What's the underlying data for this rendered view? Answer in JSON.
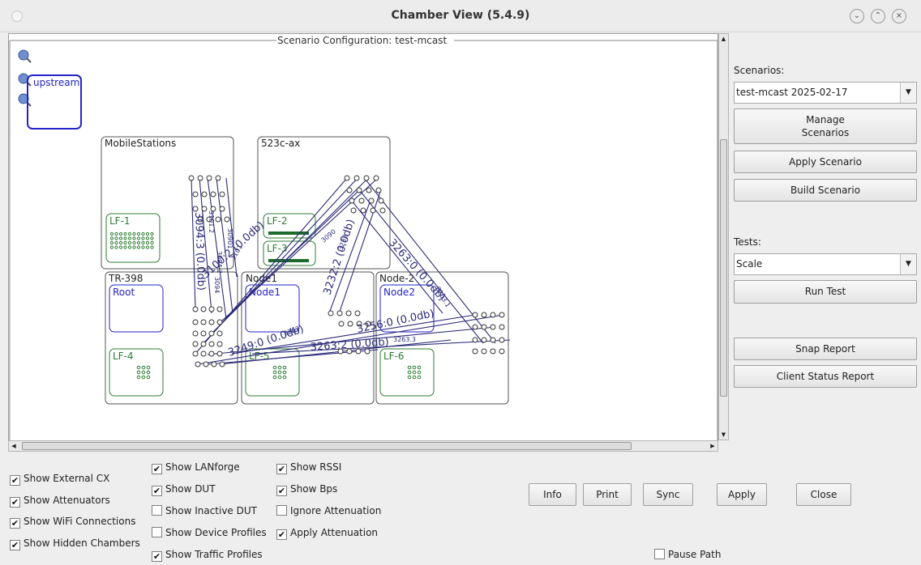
{
  "window": {
    "title": "Chamber View (5.4.9)"
  },
  "canvas": {
    "frame_title": "Scenario Configuration:  test-mcast",
    "zoom_icons": [
      "zoom-in-icon",
      "zoom-out-icon",
      "zoom-reset-icon"
    ],
    "upstream_label": "upstream",
    "chambers": [
      {
        "name": "MobileStations"
      },
      {
        "name": "523c-ax"
      },
      {
        "name": "TR-398"
      },
      {
        "name": "Node1"
      },
      {
        "name": "Node-2"
      }
    ],
    "devices": [
      {
        "name": "LF-1",
        "color": "#2e7d32"
      },
      {
        "name": "LF-2",
        "color": "#2e7d32"
      },
      {
        "name": "LF-3",
        "color": "#2e7d32"
      },
      {
        "name": "Root",
        "color": "#2323c8"
      },
      {
        "name": "Node1",
        "color": "#2323c8"
      },
      {
        "name": "Node2",
        "color": "#2323c8"
      },
      {
        "name": "LF-4",
        "color": "#2e7d32"
      },
      {
        "name": "LF-5",
        "color": "#2e7d32"
      },
      {
        "name": "LF-6",
        "color": "#2e7d32"
      }
    ],
    "link_labels": [
      "3094:3 (0.0db)",
      "3100:2 (0.0db)",
      "3232:2 (0.0db)",
      "3249:0 (0.0db)",
      "3263:2 (0.0db)",
      "3256:0 (0.0db)",
      "3263:0 (0.0db)"
    ],
    "small_labels": [
      "3101.2",
      "30901",
      "3094.2",
      "3101",
      "3090",
      "3232",
      "3263.3",
      "3263.1",
      "3094",
      "3263"
    ]
  },
  "right_panel": {
    "scenarios_label": "Scenarios:",
    "scenario_value": "test-mcast 2025-02-17",
    "manage_line1": "Manage",
    "manage_line2": "Scenarios",
    "apply_scenario": "Apply Scenario",
    "build_scenario": "Build Scenario",
    "tests_label": "Tests:",
    "test_value": "Scale",
    "run_test": "Run Test",
    "snap_report": "Snap Report",
    "client_status_report": "Client Status Report"
  },
  "checkboxes": [
    {
      "label": "Show External CX",
      "checked": true
    },
    {
      "label": "Show Attenuators",
      "checked": true
    },
    {
      "label": "Show WiFi Connections",
      "checked": true
    },
    {
      "label": "Show Hidden Chambers",
      "checked": true
    },
    {
      "label": "Show LANforge",
      "checked": true
    },
    {
      "label": "Show DUT",
      "checked": true
    },
    {
      "label": "Show Inactive DUT",
      "checked": false
    },
    {
      "label": "Show Device Profiles",
      "checked": false
    },
    {
      "label": "Show Traffic Profiles",
      "checked": true
    },
    {
      "label": "Show RSSI",
      "checked": true
    },
    {
      "label": "Show Bps",
      "checked": true
    },
    {
      "label": "Ignore Attenuation",
      "checked": false
    },
    {
      "label": "Apply Attenuation",
      "checked": true
    },
    {
      "label": "Pause Path",
      "checked": false
    }
  ],
  "buttons": {
    "info": "Info",
    "print": "Print",
    "sync": "Sync",
    "apply": "Apply",
    "close": "Close"
  },
  "colors": {
    "link": "#2b2b7a",
    "chamber_border": "#555555",
    "dut": "#2323c8",
    "lanforge": "#2e7d32"
  }
}
